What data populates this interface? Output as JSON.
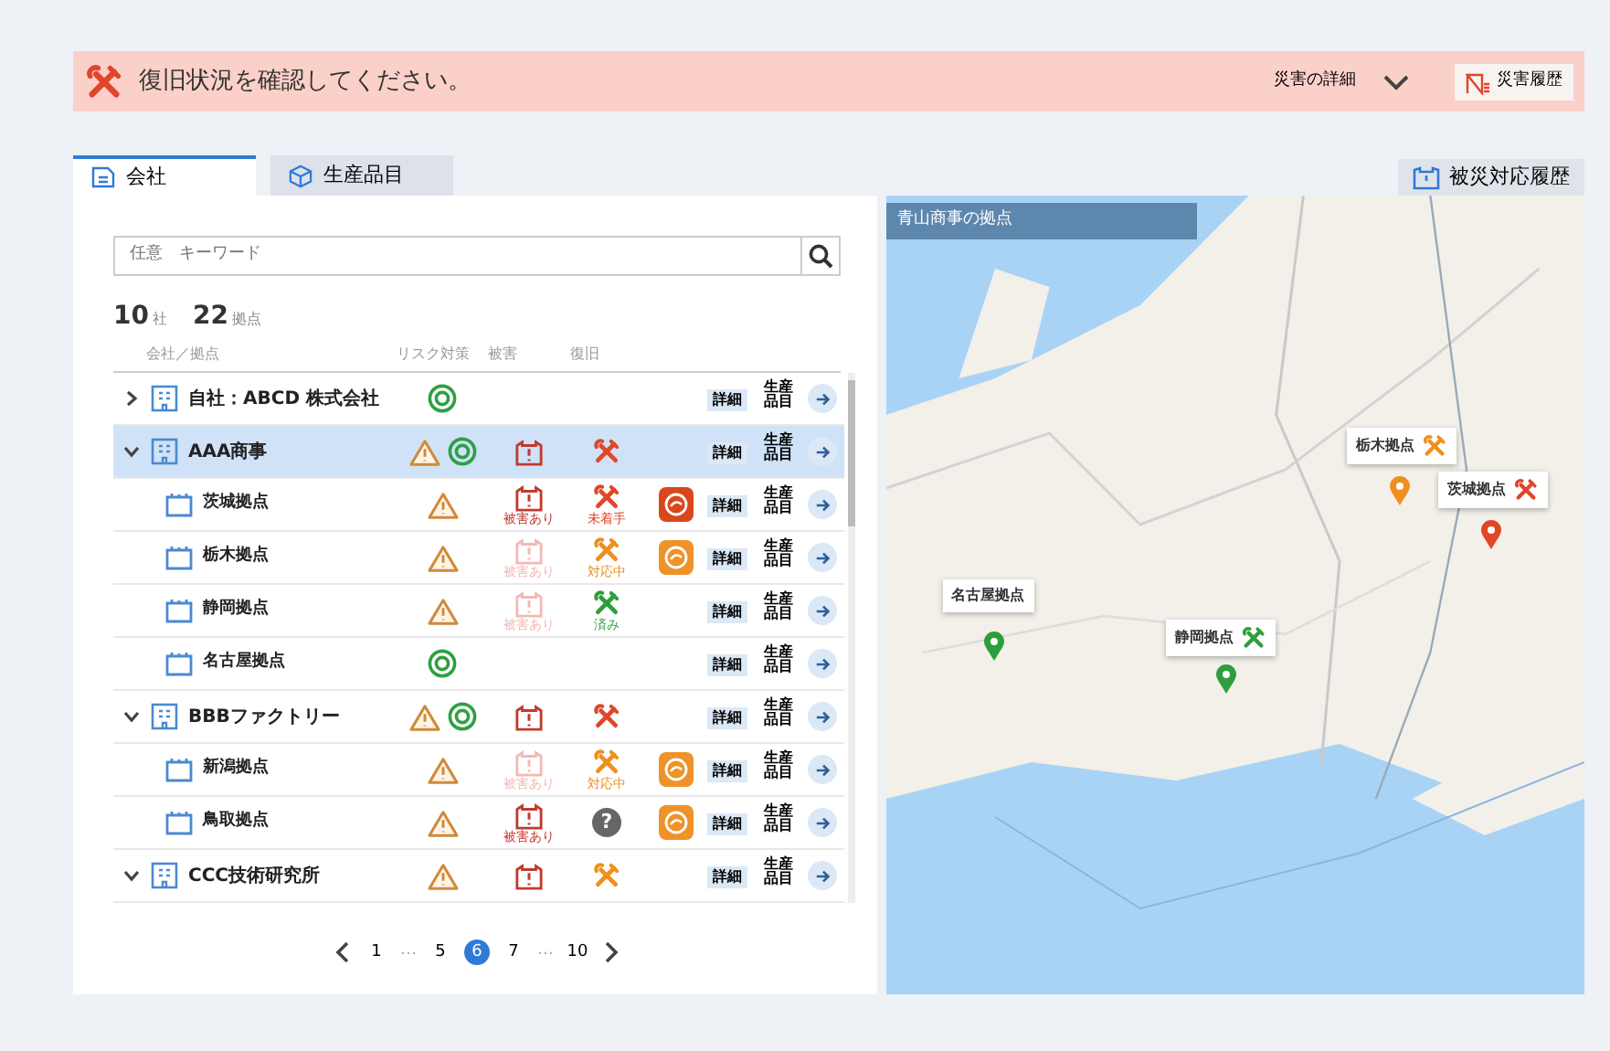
{
  "banner": {
    "message": "復旧状況を確認してください。",
    "detail_label": "災害の詳細",
    "history_button": "災害履歴"
  },
  "tabs": [
    {
      "label": "会社",
      "selected": true
    },
    {
      "label": "生産品目",
      "selected": false
    }
  ],
  "response_history_button": "被災対応履歴",
  "search": {
    "placeholder": "任意　キーワード"
  },
  "counts": [
    {
      "value": "10",
      "unit": "社"
    },
    {
      "value": "22",
      "unit": "拠点"
    }
  ],
  "columns": [
    "会社／拠点",
    "リスク対策",
    "被害",
    "復旧"
  ],
  "rows": [
    {
      "kind": "company",
      "expanded": false,
      "selected": false,
      "name": "自社：ABCD 株式会社",
      "risk": [
        {
          "kind": "ok"
        }
      ],
      "detail": "詳細",
      "products": "生産品目"
    },
    {
      "kind": "company",
      "expanded": true,
      "selected": true,
      "name": "AAA商事",
      "risk": [
        {
          "kind": "warning"
        },
        {
          "kind": "ok"
        }
      ],
      "damage": {
        "color": "#c2392c"
      },
      "recovery": {
        "kind": "tools",
        "color": "#e0462a"
      },
      "detail": "詳細",
      "products": "生産品目"
    },
    {
      "kind": "site",
      "selected": false,
      "name": "茨城拠点",
      "risk": [
        {
          "kind": "warning"
        }
      ],
      "damage": {
        "color": "#c2392c",
        "label": "被害あり"
      },
      "recovery": {
        "kind": "tools",
        "color": "#e0462a",
        "label": "未着手"
      },
      "alert": {
        "color": "#d9481c"
      },
      "detail": "詳細",
      "products": "生産品目"
    },
    {
      "kind": "site",
      "selected": false,
      "name": "栃木拠点",
      "risk": [
        {
          "kind": "warning"
        }
      ],
      "damage": {
        "color": "#f2b9b4",
        "label": "被害あり"
      },
      "recovery": {
        "kind": "tools",
        "color": "#ef8f1d",
        "label": "対応中"
      },
      "alert": {
        "color": "#ee922a"
      },
      "detail": "詳細",
      "products": "生産品目"
    },
    {
      "kind": "site",
      "selected": false,
      "name": "静岡拠点",
      "risk": [
        {
          "kind": "warning"
        }
      ],
      "damage": {
        "color": "#f2b9b4",
        "label": "被害あり"
      },
      "recovery": {
        "kind": "tools",
        "color": "#2e9e3c",
        "label": "済み"
      },
      "detail": "詳細",
      "products": "生産品目"
    },
    {
      "kind": "site",
      "selected": false,
      "name": "名古屋拠点",
      "risk": [
        {
          "kind": "ok"
        }
      ],
      "detail": "詳細",
      "products": "生産品目"
    },
    {
      "kind": "company",
      "expanded": true,
      "selected": false,
      "name": "BBBファクトリー",
      "risk": [
        {
          "kind": "warning"
        },
        {
          "kind": "ok"
        }
      ],
      "damage": {
        "color": "#c2392c"
      },
      "recovery": {
        "kind": "tools",
        "color": "#e0462a"
      },
      "detail": "詳細",
      "products": "生産品目"
    },
    {
      "kind": "site",
      "selected": false,
      "name": "新潟拠点",
      "risk": [
        {
          "kind": "warning"
        }
      ],
      "damage": {
        "color": "#f2b9b4",
        "label": "被害あり"
      },
      "recovery": {
        "kind": "tools",
        "color": "#ef8f1d",
        "label": "対応中"
      },
      "alert": {
        "color": "#ee922a"
      },
      "detail": "詳細",
      "products": "生産品目"
    },
    {
      "kind": "site",
      "selected": false,
      "name": "鳥取拠点",
      "risk": [
        {
          "kind": "warning"
        }
      ],
      "damage": {
        "color": "#c2392c",
        "label": "被害あり"
      },
      "recovery": {
        "kind": "unknown",
        "symbol": "?"
      },
      "alert": {
        "color": "#ee922a"
      },
      "detail": "詳細",
      "products": "生産品目"
    },
    {
      "kind": "company",
      "expanded": true,
      "selected": false,
      "name": "CCC技術研究所",
      "risk": [
        {
          "kind": "warning"
        }
      ],
      "damage": {
        "color": "#c2392c"
      },
      "recovery": {
        "kind": "tools",
        "color": "#ef8f1d"
      },
      "detail": "詳細",
      "products": "生産品目"
    }
  ],
  "pagination": [
    {
      "label": "1",
      "kind": "page",
      "selected": false
    },
    {
      "label": "…",
      "kind": "gap"
    },
    {
      "label": "5",
      "kind": "page",
      "selected": false
    },
    {
      "label": "6",
      "kind": "page",
      "selected": true
    },
    {
      "label": "7",
      "kind": "page",
      "selected": false
    },
    {
      "label": "…",
      "kind": "gap"
    },
    {
      "label": "10",
      "kind": "page",
      "selected": false
    }
  ],
  "map": {
    "title": "青山商事の拠点",
    "kind": "picture",
    "callouts": [
      {
        "label": "栃木拠点",
        "color": "#ef8f1d"
      },
      {
        "label": "茨城拠点",
        "color": "#e0462a"
      },
      {
        "label": "名古屋拠点"
      },
      {
        "label": "静岡拠点",
        "color": "#2e9e3c"
      }
    ],
    "pins": [
      {
        "color": "#ef8f1d"
      },
      {
        "color": "#e0462a"
      },
      {
        "color": "#2e9e3c"
      },
      {
        "color": "#2e9e3c"
      }
    ]
  }
}
